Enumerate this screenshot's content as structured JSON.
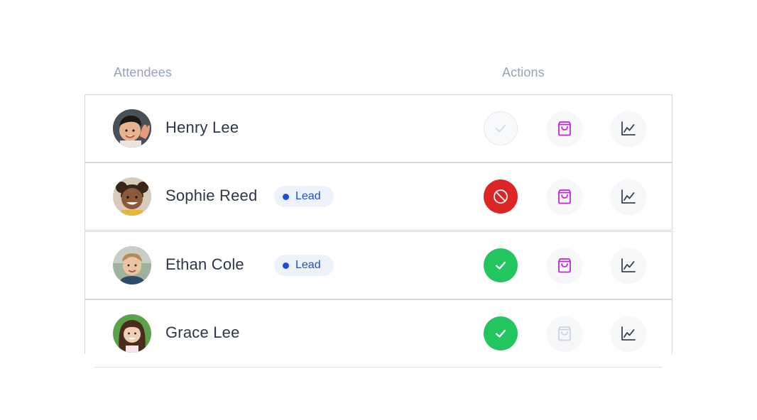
{
  "headers": {
    "attendees": "Attendees",
    "actions": "Actions"
  },
  "attendees": [
    {
      "name": "Henry Lee",
      "lead": false,
      "status": "unchecked",
      "bag_active": true,
      "avatar": "child-boy-waving"
    },
    {
      "name": "Sophie Reed",
      "lead": true,
      "lead_label": "Lead",
      "status": "declined",
      "bag_active": true,
      "avatar": "child-girl-smiling"
    },
    {
      "name": "Ethan Cole",
      "lead": true,
      "lead_label": "Lead",
      "status": "checked",
      "bag_active": true,
      "avatar": "child-boy-outdoors"
    },
    {
      "name": "Grace Lee",
      "lead": false,
      "status": "checked",
      "bag_active": false,
      "avatar": "child-girl-long-hair"
    }
  ],
  "icons": {
    "status_unchecked": "check-icon",
    "status_declined": "cancel-icon",
    "status_checked": "check-icon",
    "bag": "shopping-bag-icon",
    "chart": "line-chart-icon"
  },
  "colors": {
    "lead_badge_bg": "#eef2fb",
    "lead_badge_text": "#1d4ed8",
    "declined": "#dc2626",
    "checked": "#22c55e",
    "bag_active": "#c026d3",
    "bag_inactive": "#cbd5e1",
    "chart": "#374151",
    "header_text": "#94a3b8",
    "name_text": "#2d3748"
  }
}
